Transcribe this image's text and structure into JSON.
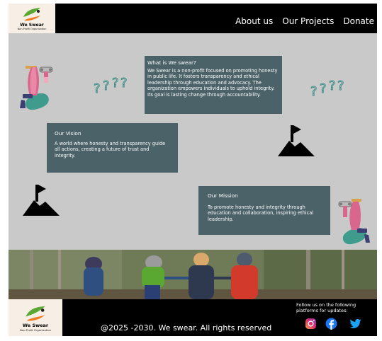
{
  "header": {
    "logo": {
      "brand": "We Swear",
      "subtitle": "Non-Profit Organization"
    },
    "nav": [
      {
        "label": "About us"
      },
      {
        "label": "Our Projects"
      },
      {
        "label": "Donate"
      }
    ]
  },
  "main": {
    "about": {
      "title": "What is We swear?",
      "text": "We Swear is a non-profit focused on promoting honesty in public life. It fosters transparency and ethical leadership through education and advocacy. The organization empowers individuals to uphold integrity. Its goal is lasting change through accountability."
    },
    "vision": {
      "title": "Our Vision",
      "text": "A world where honesty and transparency guide all actions, creating a future of trust and integrity."
    },
    "mission": {
      "title": "Our Mission",
      "text": "To promote honesty and integrity through education and collaboration, inspiring ethical leadership."
    }
  },
  "footer": {
    "logo": {
      "brand": "We Swear",
      "subtitle": "Non-Profit Organization"
    },
    "copyright": "@2025 -2030. We swear. All rights reserved",
    "follow_text": "Follow us on the following platforms for updates:",
    "social_icons": [
      "instagram-icon",
      "facebook-icon",
      "twitter-icon"
    ]
  },
  "colors": {
    "header_bg": "#000000",
    "page_bg": "#c9c9c9",
    "card_bg": "#4c6269",
    "logo_bg": "#f7eee6",
    "accent_green": "#5aa832",
    "accent_orange": "#ef7c22",
    "facebook_blue": "#1877f2",
    "twitter_blue": "#1da1f2"
  }
}
